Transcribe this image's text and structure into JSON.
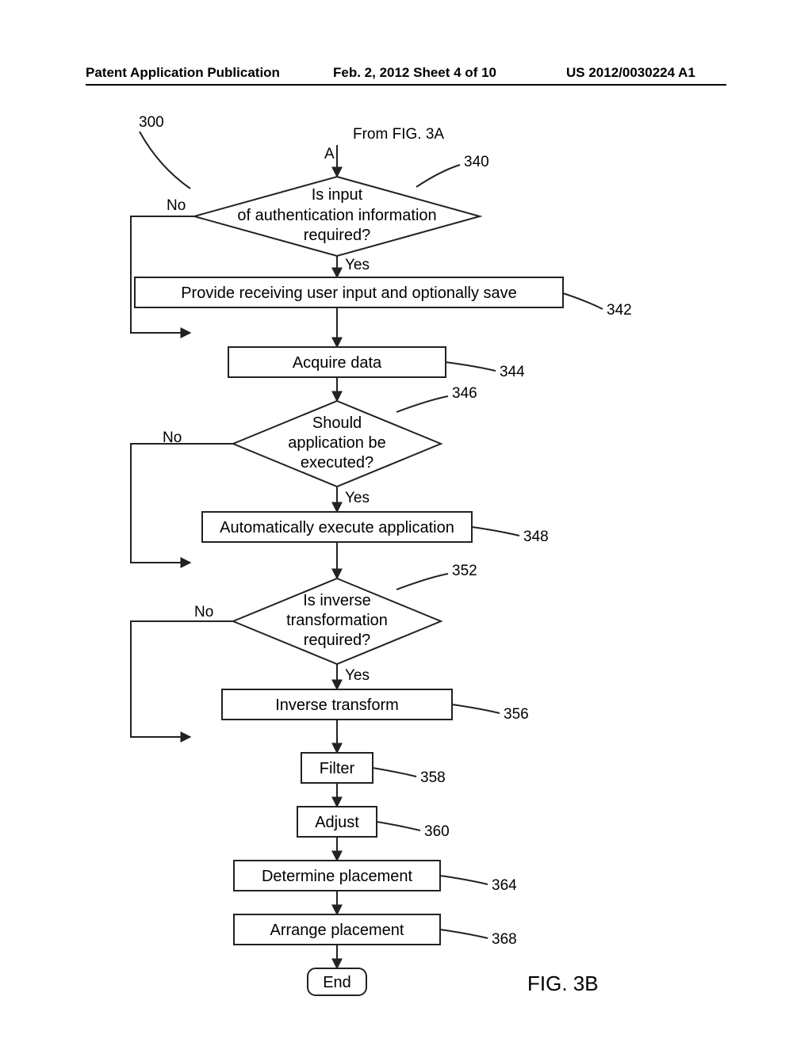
{
  "header": {
    "left": "Patent Application Publication",
    "center": "Feb. 2, 2012   Sheet 4 of 10",
    "right": "US 2012/0030224 A1"
  },
  "flow": {
    "ref_300": "300",
    "from_label": "From  FIG. 3A",
    "connector_A": "A",
    "d340": {
      "ref": "340",
      "l1": "Is input",
      "l2": "of authentication information",
      "l3": "required?",
      "yes": "Yes",
      "no": "No"
    },
    "b342": {
      "ref": "342",
      "text": "Provide receiving user input and optionally save"
    },
    "b344": {
      "ref": "344",
      "text": "Acquire data"
    },
    "d346": {
      "ref": "346",
      "l1": "Should",
      "l2": "application be",
      "l3": "executed?",
      "yes": "Yes",
      "no": "No"
    },
    "b348": {
      "ref": "348",
      "text": "Automatically execute application"
    },
    "d352": {
      "ref": "352",
      "l1": "Is inverse",
      "l2": "transformation",
      "l3": "required?",
      "yes": "Yes",
      "no": "No"
    },
    "b356": {
      "ref": "356",
      "text": "Inverse transform"
    },
    "b358": {
      "ref": "358",
      "text": "Filter"
    },
    "b360": {
      "ref": "360",
      "text": "Adjust"
    },
    "b364": {
      "ref": "364",
      "text": "Determine placement"
    },
    "b368": {
      "ref": "368",
      "text": "Arrange placement"
    },
    "end": "End",
    "fig_label": "FIG. 3B"
  }
}
